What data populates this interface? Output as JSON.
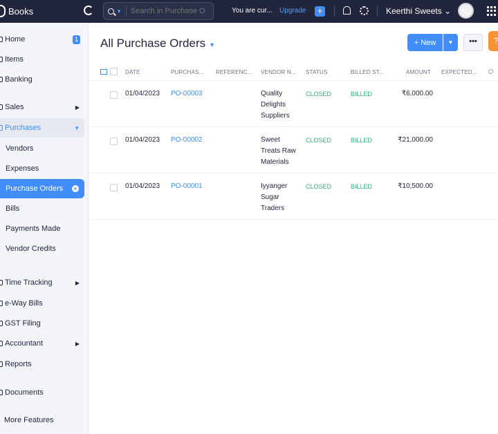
{
  "topbar": {
    "app_name": "Books",
    "search_placeholder": "Search in Purchase O",
    "trial_text": "You are cur...",
    "upgrade_label": "Upgrade",
    "org_name": "Keerthi Sweets",
    "org_caret": "⌄"
  },
  "sidebar": {
    "items": [
      {
        "label": "Home",
        "badge": "1"
      },
      {
        "label": "Items"
      },
      {
        "label": "Banking"
      },
      {
        "label": "Sales",
        "arrow": "▶"
      },
      {
        "label": "Purchases",
        "arrow": "▼"
      },
      {
        "label": "Vendors"
      },
      {
        "label": "Expenses"
      },
      {
        "label": "Purchase Orders",
        "add": "+"
      },
      {
        "label": "Bills"
      },
      {
        "label": "Payments Made"
      },
      {
        "label": "Vendor Credits"
      },
      {
        "label": "Time Tracking",
        "arrow": "▶"
      },
      {
        "label": "e-Way Bills"
      },
      {
        "label": "GST Filing"
      },
      {
        "label": "Accountant",
        "arrow": "▶"
      },
      {
        "label": "Reports"
      },
      {
        "label": "Documents"
      },
      {
        "label": "More Features"
      }
    ]
  },
  "main": {
    "title": "All Purchase Orders",
    "title_caret": "⌄",
    "new_label": "New",
    "new_plus": "+",
    "more_label": "•••",
    "help_label": "?"
  },
  "table": {
    "columns": [
      "DATE",
      "PURCHAS...",
      "REFERENC...",
      "VENDOR N...",
      "STATUS",
      "BILLED ST...",
      "AMOUNT",
      "EXPECTED..."
    ],
    "rows": [
      {
        "date": "01/04/2023",
        "po": "PO-00003",
        "reference": "",
        "vendor": "Quality Delights Suppliers",
        "status": "CLOSED",
        "billed": "BILLED",
        "amount": "₹6,000.00",
        "expected": ""
      },
      {
        "date": "01/04/2023",
        "po": "PO-00002",
        "reference": "",
        "vendor": "Sweet Treats Raw Materials",
        "status": "CLOSED",
        "billed": "BILLED",
        "amount": "₹21,000.00",
        "expected": ""
      },
      {
        "date": "01/04/2023",
        "po": "PO-00001",
        "reference": "",
        "vendor": "Iyyanger Sugar Traders",
        "status": "CLOSED",
        "billed": "BILLED",
        "amount": "₹10,500.00",
        "expected": ""
      }
    ]
  },
  "colors": {
    "accent": "#408dfb",
    "topbar_bg": "#21263c",
    "status_green": "#22b378",
    "help_orange": "#f79232"
  }
}
